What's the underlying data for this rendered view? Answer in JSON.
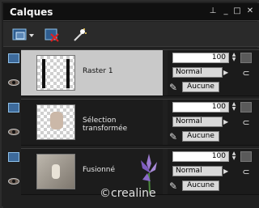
{
  "panel": {
    "title": "Calques"
  },
  "window_controls": [
    "pin-icon",
    "minimize-icon",
    "maximize-icon",
    "close-icon"
  ],
  "toolbar": {
    "icons": [
      "new-layer-icon",
      "delete-layer-icon",
      "magic-wand-icon"
    ]
  },
  "layers": [
    {
      "name": "Raster 1",
      "opacity": "100",
      "blend": "Normal",
      "mask_label": "Aucune",
      "selected": true
    },
    {
      "name": "Sélection transformée",
      "opacity": "100",
      "blend": "Normal",
      "mask_label": "Aucune",
      "selected": false
    },
    {
      "name": "Fusionné",
      "opacity": "100",
      "blend": "Normal",
      "mask_label": "Aucune",
      "selected": false
    }
  ],
  "watermark": "©crealine"
}
